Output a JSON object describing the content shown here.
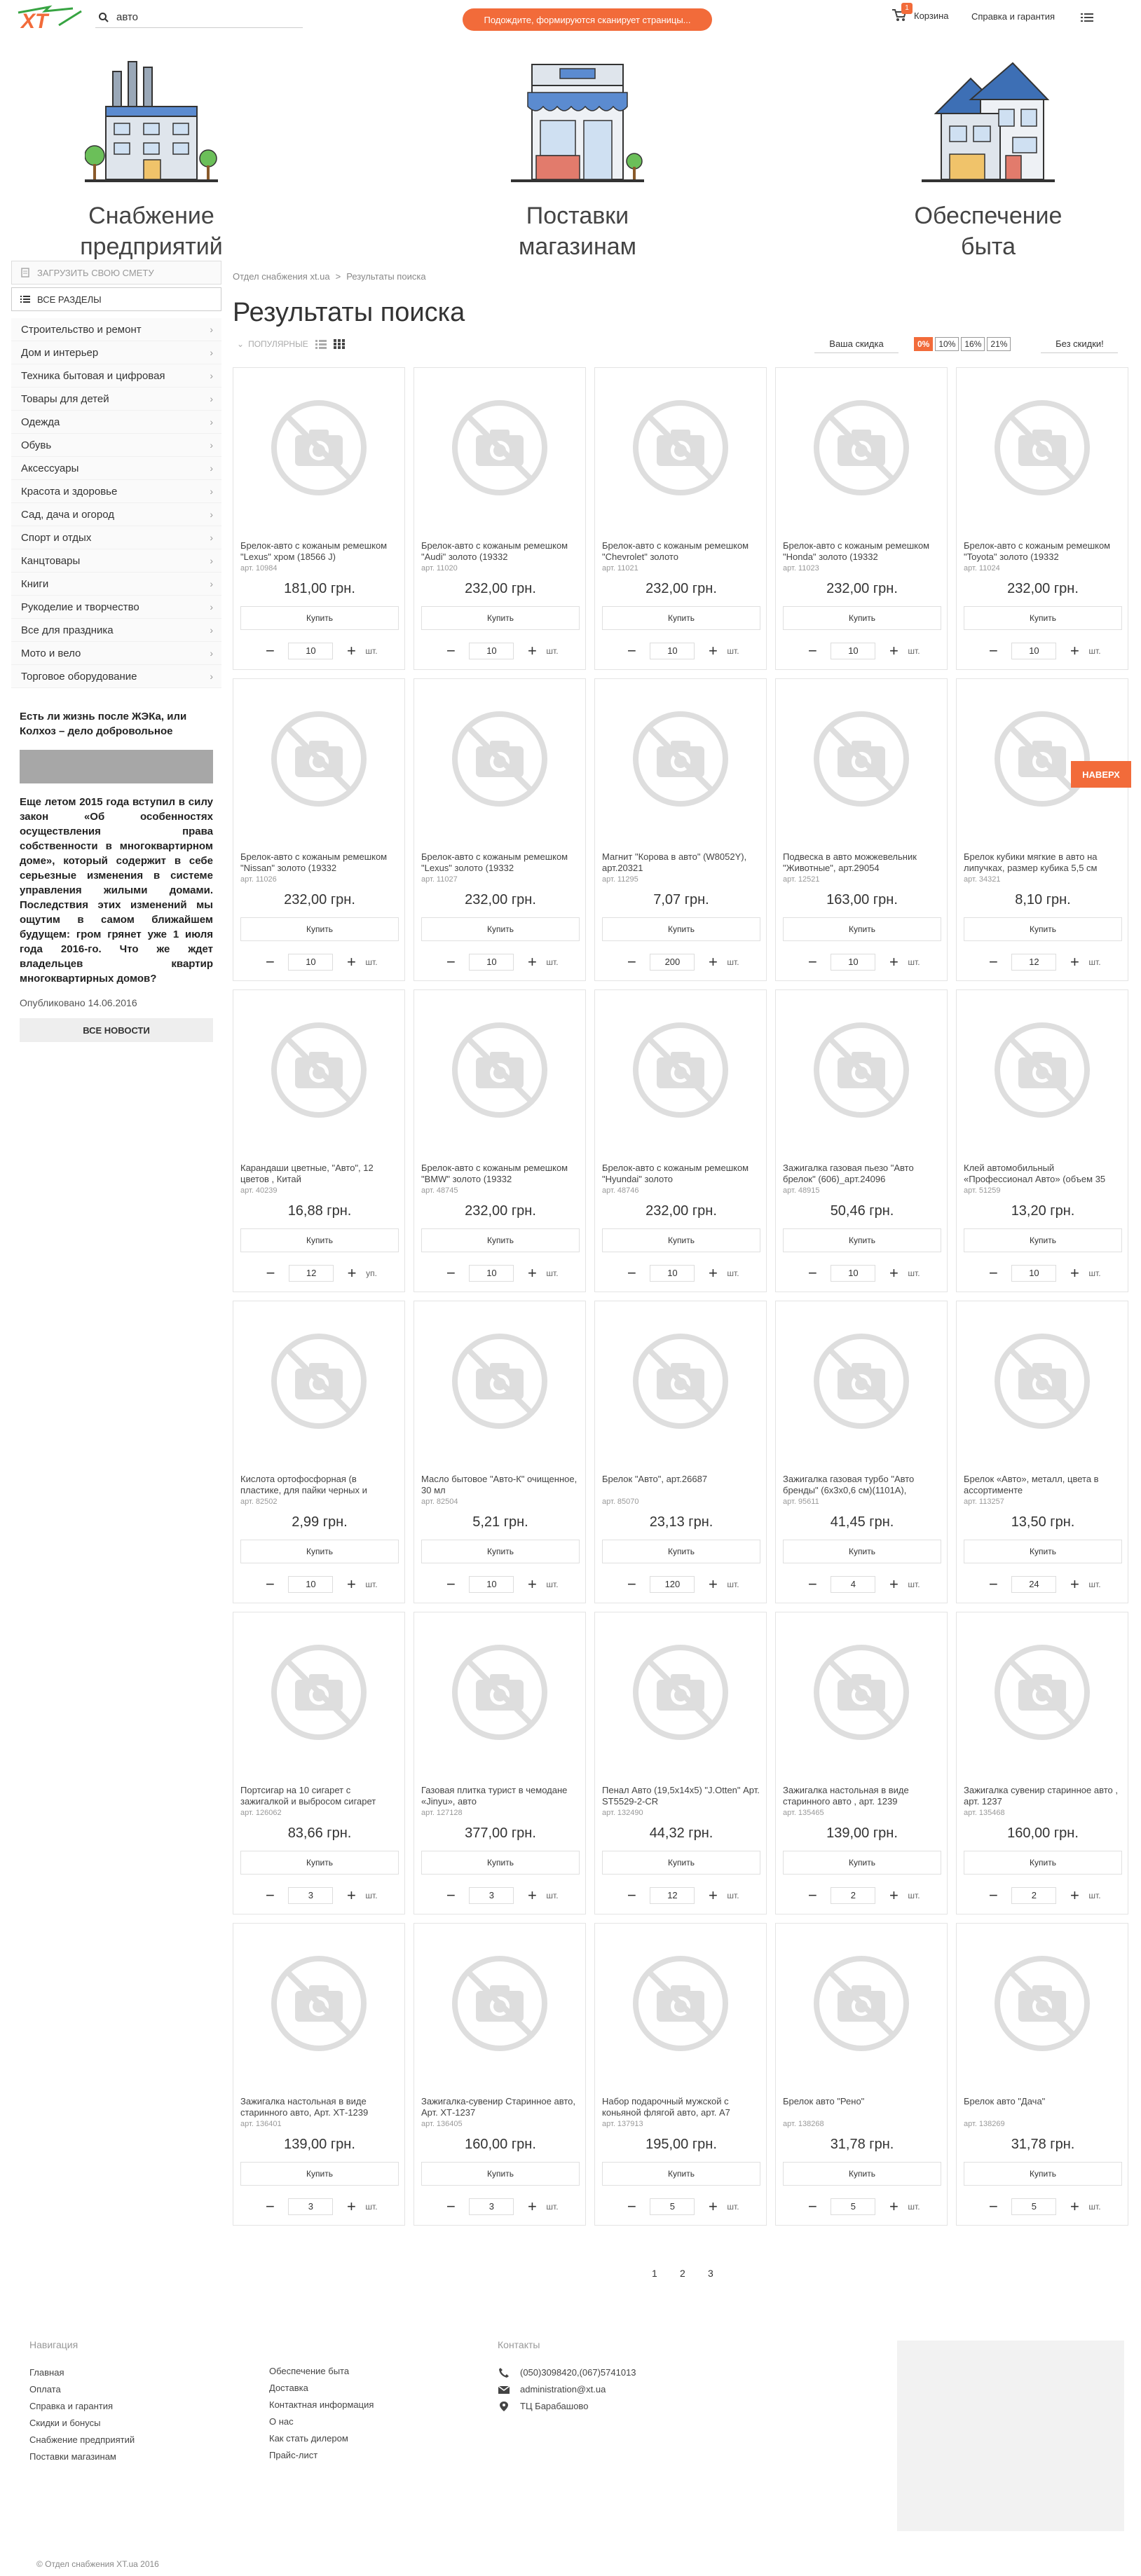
{
  "header": {
    "search_value": "авто",
    "promo": "Подождите, формируются сканирует страницы...",
    "cart_count": "1",
    "cart_label": "Корзина",
    "help_link": "Справка и гарантия",
    "colors": {
      "accent": "#f26b3a",
      "logo_green": "#37a442"
    }
  },
  "heroes": [
    {
      "line1": "Снабжение",
      "line2": "предприятий"
    },
    {
      "line1": "Поставки",
      "line2": "магазинам"
    },
    {
      "line1": "Обеспечение",
      "line2": "быта"
    }
  ],
  "sidebar": {
    "upload": "ЗАГРУЗИТЬ СВОЮ СМЕТУ",
    "all_sections": "ВСЕ РАЗДЕЛЫ",
    "categories": [
      "Строительство и ремонт",
      "Дом и интерьер",
      "Техника бытовая и цифровая",
      "Товары для детей",
      "Одежда",
      "Обувь",
      "Аксессуары",
      "Красота и здоровье",
      "Сад, дача и огород",
      "Спорт и отдых",
      "Канцтовары",
      "Книги",
      "Рукоделие и творчество",
      "Все для праздника",
      "Мото и вело",
      "Торговое оборудование"
    ],
    "news": {
      "title": "Есть ли жизнь после ЖЭКа, или Колхоз – дело добровольное",
      "body": "Еще летом 2015 года вступил в силу закон «Об особенностях осуществления права собственности в многоквартирном доме», который содержит в себе серьезные изменения в системе управления жилыми домами. Последствия этих изменений мы ощутим в самом ближайшем будущем: гром грянет уже 1 июля года 2016-го. Что же ждет владельцев квартир многоквартирных домов?",
      "date": "Опубликовано 14.06.2016",
      "all": "ВСЕ НОВОСТИ"
    }
  },
  "breadcrumb": {
    "a": "Отдел снабжения xt.ua",
    "b": "Результаты поиска"
  },
  "title": "Результаты поиска",
  "toolbar": {
    "sort": "ПОПУЛЯРНЫЕ",
    "discount_label": "Ваша скидка",
    "discounts": [
      "0%",
      "10%",
      "16%",
      "21%"
    ],
    "no_discount": "Без скидки!"
  },
  "buy_label": "Купить",
  "products": [
    {
      "name": "Брелок-авто с кожаным ремешком \"Lexus\" хром (18566 J)",
      "art": "арт. 10984",
      "price": "181,00 грн.",
      "qty": "10",
      "unit": "шт."
    },
    {
      "name": "Брелок-авто с кожаным ремешком \"Audi\" золото (19332",
      "art": "арт. 11020",
      "price": "232,00 грн.",
      "qty": "10",
      "unit": "шт."
    },
    {
      "name": "Брелок-авто с кожаным ремешком \"Chevrolet\" золото",
      "art": "арт. 11021",
      "price": "232,00 грн.",
      "qty": "10",
      "unit": "шт."
    },
    {
      "name": "Брелок-авто с кожаным ремешком \"Honda\" золото (19332",
      "art": "арт. 11023",
      "price": "232,00 грн.",
      "qty": "10",
      "unit": "шт."
    },
    {
      "name": "Брелок-авто с кожаным ремешком \"Toyota\" золото (19332",
      "art": "арт. 11024",
      "price": "232,00 грн.",
      "qty": "10",
      "unit": "шт."
    },
    {
      "name": "Брелок-авто с кожаным ремешком \"Nissan\" золото (19332",
      "art": "арт. 11026",
      "price": "232,00 грн.",
      "qty": "10",
      "unit": "шт."
    },
    {
      "name": "Брелок-авто с кожаным ремешком \"Lexus\" золото (19332",
      "art": "арт. 11027",
      "price": "232,00 грн.",
      "qty": "10",
      "unit": "шт."
    },
    {
      "name": "Магнит \"Корова в авто\" (W8052Y), арт.20321",
      "art": "арт. 11295",
      "price": "7,07 грн.",
      "qty": "200",
      "unit": "шт."
    },
    {
      "name": "Подвеска в авто можжевельник \"Животные\", арт.29054",
      "art": "арт. 12521",
      "price": "163,00 грн.",
      "qty": "10",
      "unit": "шт."
    },
    {
      "name": "Брелок кубики мягкие в авто на липучках, размер кубика 5,5 см",
      "art": "арт. 34321",
      "price": "8,10 грн.",
      "qty": "12",
      "unit": "шт."
    },
    {
      "name": "Карандаши цветные, \"Авто\", 12 цветов , Китай",
      "art": "арт. 40239",
      "price": "16,88 грн.",
      "qty": "12",
      "unit": "уп."
    },
    {
      "name": "Брелок-авто с кожаным ремешком \"BMW\" золото (19332",
      "art": "арт. 48745",
      "price": "232,00 грн.",
      "qty": "10",
      "unit": "шт."
    },
    {
      "name": "Брелок-авто с кожаным ремешком \"Hyundai\" золото",
      "art": "арт. 48746",
      "price": "232,00 грн.",
      "qty": "10",
      "unit": "шт."
    },
    {
      "name": "Зажигалка газовая пьезо \"Авто брелок\" (606)_арт.24096",
      "art": "арт. 48915",
      "price": "50,46 грн.",
      "qty": "10",
      "unit": "шт."
    },
    {
      "name": "Клей автомобильный «Профессионал Авто» (объем 35",
      "art": "арт. 51259",
      "price": "13,20 грн.",
      "qty": "10",
      "unit": "шт."
    },
    {
      "name": "Кислота ортофосфорная (в пластике, для пайки черных и",
      "art": "арт. 82502",
      "price": "2,99 грн.",
      "qty": "10",
      "unit": "шт."
    },
    {
      "name": "Масло бытовое \"Авто-К\" очищенное, 30 мл",
      "art": "арт. 82504",
      "price": "5,21 грн.",
      "qty": "10",
      "unit": "шт."
    },
    {
      "name": "Брелок \"Авто\", арт.26687",
      "art": "арт. 85070",
      "price": "23,13 грн.",
      "qty": "120",
      "unit": "шт."
    },
    {
      "name": "Зажигалка газовая турбо \"Авто бренды\" (6x3x0,6 см)(1101A),",
      "art": "арт. 95611",
      "price": "41,45 грн.",
      "qty": "4",
      "unit": "шт."
    },
    {
      "name": "Брелок «Авто», металл, цвета в ассортименте",
      "art": "арт. 113257",
      "price": "13,50 грн.",
      "qty": "24",
      "unit": "шт."
    },
    {
      "name": "Портсигар на 10 сигарет с зажигалкой и выбросом сигарет",
      "art": "арт. 126062",
      "price": "83,66 грн.",
      "qty": "3",
      "unit": "шт."
    },
    {
      "name": "Газовая плитка турист в чемодане «Jinyu», авто",
      "art": "арт. 127128",
      "price": "377,00 грн.",
      "qty": "3",
      "unit": "шт."
    },
    {
      "name": "Пенал Авто (19,5x14x5) \"J.Otten\" Арт. ST5529-2-CR",
      "art": "арт. 132490",
      "price": "44,32 грн.",
      "qty": "12",
      "unit": "шт."
    },
    {
      "name": "Зажигалка настольная в виде старинного авто , арт. 1239",
      "art": "арт. 135465",
      "price": "139,00 грн.",
      "qty": "2",
      "unit": "шт."
    },
    {
      "name": "Зажигалка сувенир старинное авто , арт. 1237",
      "art": "арт. 135468",
      "price": "160,00 грн.",
      "qty": "2",
      "unit": "шт."
    },
    {
      "name": "Зажигалка настольная в виде старинного авто, Арт. ХТ-1239",
      "art": "арт. 136401",
      "price": "139,00 грн.",
      "qty": "3",
      "unit": "шт."
    },
    {
      "name": "Зажигалка-сувенир Старинное авто, Арт. ХТ-1237",
      "art": "арт. 136405",
      "price": "160,00 грн.",
      "qty": "3",
      "unit": "шт."
    },
    {
      "name": "Набор подарочный мужской с коньяной флягой авто, арт. А7",
      "art": "арт. 137913",
      "price": "195,00 грн.",
      "qty": "5",
      "unit": "шт."
    },
    {
      "name": "Брелок авто \"Рено\"",
      "art": "арт. 138268",
      "price": "31,78 грн.",
      "qty": "5",
      "unit": "шт."
    },
    {
      "name": "Брелок авто \"Дача\"",
      "art": "арт. 138269",
      "price": "31,78 грн.",
      "qty": "5",
      "unit": "шт."
    }
  ],
  "top_button": "НАВЕРХ",
  "pagination": [
    "1",
    "2",
    "3"
  ],
  "footer": {
    "nav_title": "Навигация",
    "nav_col1": [
      "Главная",
      "Оплата",
      "Справка и гарантия",
      "Скидки и бонусы",
      "Снабжение предприятий",
      "Поставки магазинам"
    ],
    "nav_col2": [
      "Обеспечение быта",
      "Доставка",
      "Контактная информация",
      "О нас",
      "Как стать дилером",
      "Прайс-лист"
    ],
    "contacts_title": "Контакты",
    "phone": "(050)3098420,(067)5741013",
    "email": "administration@xt.ua",
    "address": "ТЦ Барабашово",
    "copyright": "© Отдел снабжения ХТ.ua 2016"
  }
}
